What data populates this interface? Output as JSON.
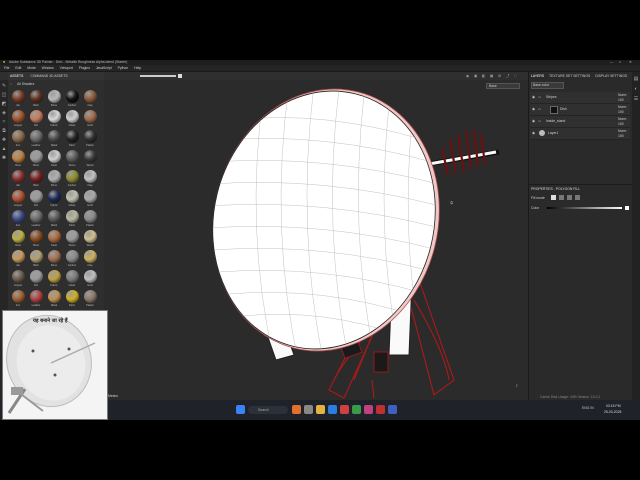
{
  "app": {
    "window_title": "Adobe Substance 3D Painter - Dish - Metallic Roughness Alpha-blend (Starter)"
  },
  "menu": [
    "File",
    "Edit",
    "Mode",
    "Window",
    "Viewport",
    "Plugins",
    "JavaScript",
    "Python",
    "Help"
  ],
  "assets_panel": {
    "tabs": [
      "ASSETS",
      "COMMAND 3D ASSETS"
    ],
    "filter_label": "All Shaders",
    "swatch_colors": [
      "#7a3b25",
      "#5e3120",
      "#b9b9b9",
      "#111111",
      "#8a5a3a",
      "#a0522d",
      "#c77a5a",
      "#d8d8d8",
      "#cfcfcf",
      "#a06a4a",
      "#8a6a4a",
      "#6a6a6a",
      "#4a4a4a",
      "#222222",
      "#303030",
      "#c08040",
      "#999999",
      "#d0d0d0",
      "#5a5a5a",
      "#3a3a3a",
      "#8b2e2e",
      "#7a2020",
      "#b0b0b0",
      "#8c8c30",
      "#c0c0c0",
      "#b05030",
      "#9a9a9a",
      "#1f2a5a",
      "#c0c0b0",
      "#aaaaaa",
      "#3c4a8a",
      "#6a6a6a",
      "#5a5a5a",
      "#b8b8a0",
      "#8a8a8a",
      "#c0b040",
      "#8a4a20",
      "#aa6a40",
      "#9a9a9a",
      "#d0c090",
      "#c89858",
      "#b0a070",
      "#a07050",
      "#8a8a8a",
      "#d0b060",
      "#6a5a4a",
      "#9a9a9a",
      "#c0a040",
      "#7a7a7a",
      "#c0c0c0",
      "#a06030",
      "#b04040",
      "#c09050",
      "#d0b020",
      "#8a7a6a",
      "#a0a0a0",
      "#808080",
      "#6a4a3a",
      "#c0c0c0",
      "#b0b0b0"
    ],
    "swatch_labels": [
      "Alu",
      "Bark",
      "Bone",
      "Carbon",
      "Clay",
      "Copper",
      "Dirt",
      "Fabric",
      "Glass",
      "Gold",
      "Iron",
      "Leather",
      "Metal",
      "Paint",
      "Plastic",
      "Rust",
      "Silver",
      "Steel",
      "Stone",
      "Wood"
    ]
  },
  "viewport": {
    "dropdown": "Base",
    "bottom_label": "Meshs"
  },
  "layers_panel": {
    "tabs": [
      "LAYERS",
      "TEXTURE SET SETTINGS",
      "DISPLAY SETTINGS"
    ],
    "texture_set": "Base color",
    "layers": [
      {
        "name": "Stripes",
        "blend": "Norm",
        "opacity": "100"
      },
      {
        "name": "Dish",
        "blend": "Norm",
        "opacity": "100"
      },
      {
        "name": "Inside_stand",
        "blend": "Norm",
        "opacity": "100"
      },
      {
        "name": "Layer1",
        "blend": "Norm",
        "opacity": "100"
      }
    ]
  },
  "properties_panel": {
    "title": "PROPERTIES - POLYGON FILL",
    "fill_mode": "Fill mode",
    "color_label": "Color",
    "mesh_label": "Mesh"
  },
  "status_bar": {
    "text": "Cache Disk Usage: 44%  Version: 10.0.1"
  },
  "taskbar": {
    "search_placeholder": "Search",
    "time": "03:15 PM",
    "date": "25-03-2025",
    "lang": "ENG IN"
  },
  "overlay_photo": {
    "caption": "यह बनाने जा रहे हैं"
  }
}
